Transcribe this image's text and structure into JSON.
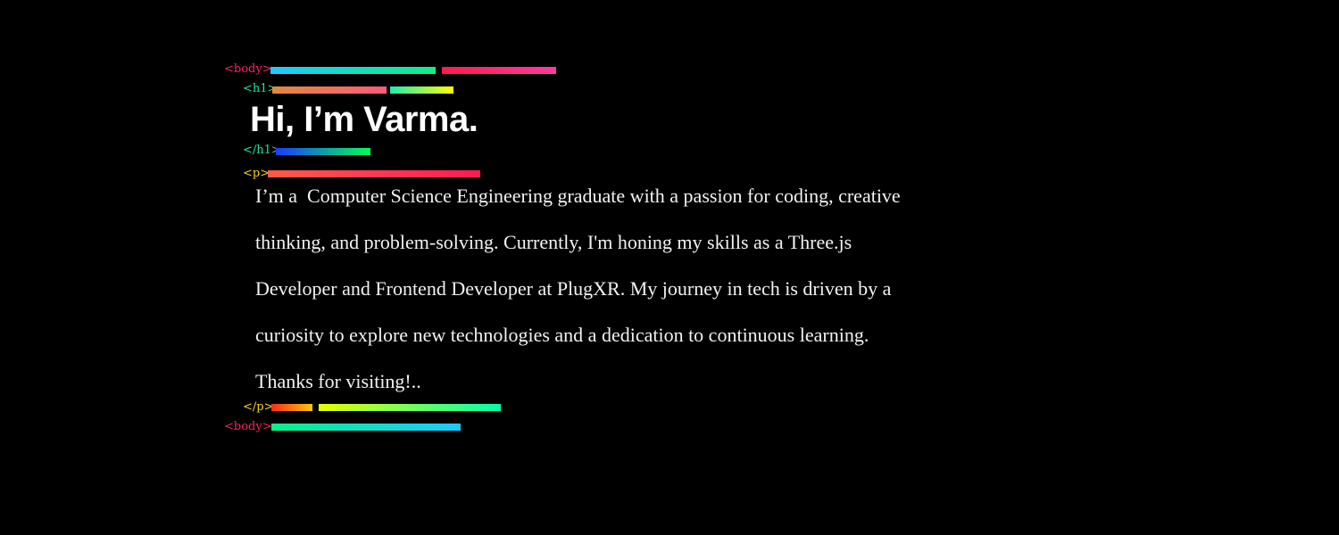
{
  "tags": {
    "body_open": "<body>",
    "h1_open": "<h1>",
    "h1_close": "</h1>",
    "p_open": "<p>",
    "p_close": "</p>",
    "body_close": "<body>"
  },
  "intro": {
    "heading": "Hi, I’m Varma.",
    "paragraph_lines": [
      "I’m a  Computer Science Engineering graduate with a passion for coding, creative",
      "thinking, and problem-solving. Currently, I'm honing my skills as a Three.js",
      "Developer and Frontend Developer at PlugXR. My journey in tech is driven by a",
      "curiosity to explore new technologies and a dedication to continuous learning.",
      "Thanks for visiting!.."
    ]
  },
  "colors": {
    "background": "#000000",
    "heading": "#ffffff",
    "text": "#f2f2f2",
    "tag_body": "#ff1f6b",
    "tag_h1": "#19e3a8",
    "tag_p": "#ffd21f"
  }
}
